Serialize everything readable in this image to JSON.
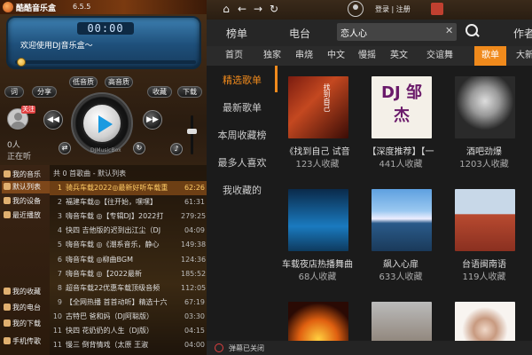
{
  "app": {
    "title": "酷酷音乐盒",
    "version": "6.5.5"
  },
  "player": {
    "time": "00:00",
    "welcome": "欢迎使用DJ音乐盒～",
    "progress": 0.02,
    "buttons": {
      "lyrics": "词",
      "share": "分享",
      "low_quality": "低音质",
      "high_quality": "高音质",
      "favorite": "收藏",
      "download": "下载"
    },
    "follow_badge": "关注",
    "listeners": "0人",
    "listening": "正在听",
    "brand": "DJMusicBox",
    "volume": 0.6
  },
  "sidebar": {
    "items": [
      {
        "label": "我的音乐",
        "icon": "music-icon"
      },
      {
        "label": "默认列表",
        "icon": "list-icon",
        "active": true
      },
      {
        "label": "我的设备",
        "icon": "device-icon"
      },
      {
        "label": "最近播放",
        "icon": "clock-icon"
      },
      {
        "label": "我的收藏",
        "icon": "heart-icon"
      },
      {
        "label": "我的电台",
        "icon": "radio-icon"
      },
      {
        "label": "我的下载",
        "icon": "download-icon"
      },
      {
        "label": "手机传歌",
        "icon": "phone-icon"
      }
    ]
  },
  "playlist": {
    "header": "共 0 首歌曲 - 默认列表",
    "rows": [
      {
        "n": "1",
        "title": "骑兵车载2022◎最新好听车载重",
        "dur": "62:26",
        "active": true
      },
      {
        "n": "2",
        "title": "福建车载◎【往开始，嘿嘿】",
        "dur": "61:31"
      },
      {
        "n": "3",
        "title": "嗨音车载 ◎【专辑DJ】2022打",
        "dur": "279:25"
      },
      {
        "n": "4",
        "title": "快四 吉他版的迟到出江尘（DJ",
        "dur": "04:09"
      },
      {
        "n": "5",
        "title": "嗨音车载 ◎《潮系音乐，静心",
        "dur": "149:38"
      },
      {
        "n": "6",
        "title": "嗨音车载 ◎柳曲BGM",
        "dur": "124:36"
      },
      {
        "n": "7",
        "title": "嗨音车载 ◎【2022最新",
        "dur": "185:52"
      },
      {
        "n": "8",
        "title": "超音车载22优惠车载顶级音频",
        "dur": "112:05"
      },
      {
        "n": "9",
        "title": "【全网热播 首首动听】精选十六",
        "dur": "67:19"
      },
      {
        "n": "10",
        "title": "古特巴 爸和妈（DJ阿聪版）",
        "dur": "03:30"
      },
      {
        "n": "11",
        "title": "快四 花奶奶的人生（DJ版）",
        "dur": "04:15"
      },
      {
        "n": "11",
        "title": "慢三 倒背情戏（太原 王淑",
        "dur": "04:00"
      }
    ]
  },
  "topbar": {
    "login": "登录 | 注册"
  },
  "nav1": {
    "tabs": [
      "榜单",
      "电台",
      "作者"
    ],
    "search_value": "恋人心",
    "search_placeholder": ""
  },
  "categories": [
    {
      "label": "首页"
    },
    {
      "label": "独家"
    },
    {
      "label": "串烧"
    },
    {
      "label": "中文"
    },
    {
      "label": "慢摇"
    },
    {
      "label": "英文"
    },
    {
      "label": "交谊舞"
    },
    {
      "label": "歌单",
      "active": true
    },
    {
      "label": "大新"
    }
  ],
  "subnav": [
    "精选歌单",
    "最新歌单",
    "本周收藏榜",
    "最多人喜欢",
    "我收藏的"
  ],
  "cards": [
    {
      "title": "《找到自己 试音",
      "count": "123人收藏",
      "cover_text": "找到自己"
    },
    {
      "title": "【深度推荐】【一",
      "count": "441人收藏",
      "cover_text": "DJ 邹杰"
    },
    {
      "title": "酒吧劲爆",
      "count": "1203人收藏",
      "cover_text": ""
    },
    {
      "title": "车载夜店热播舞曲",
      "count": "68人收藏",
      "cover_text": ""
    },
    {
      "title": "飙入心扉",
      "count": "633人收藏",
      "cover_text": ""
    },
    {
      "title": "台语闽南语",
      "count": "119人收藏",
      "cover_text": ""
    },
    {
      "title": "",
      "count": "",
      "cover_text": ""
    },
    {
      "title": "",
      "count": "",
      "cover_text": ""
    },
    {
      "title": "",
      "count": "",
      "cover_text": ""
    }
  ],
  "status": {
    "danmu": "弹幕已关闭"
  },
  "colors": {
    "accent": "#f08a1c",
    "lcd": "#1e4f7a"
  }
}
